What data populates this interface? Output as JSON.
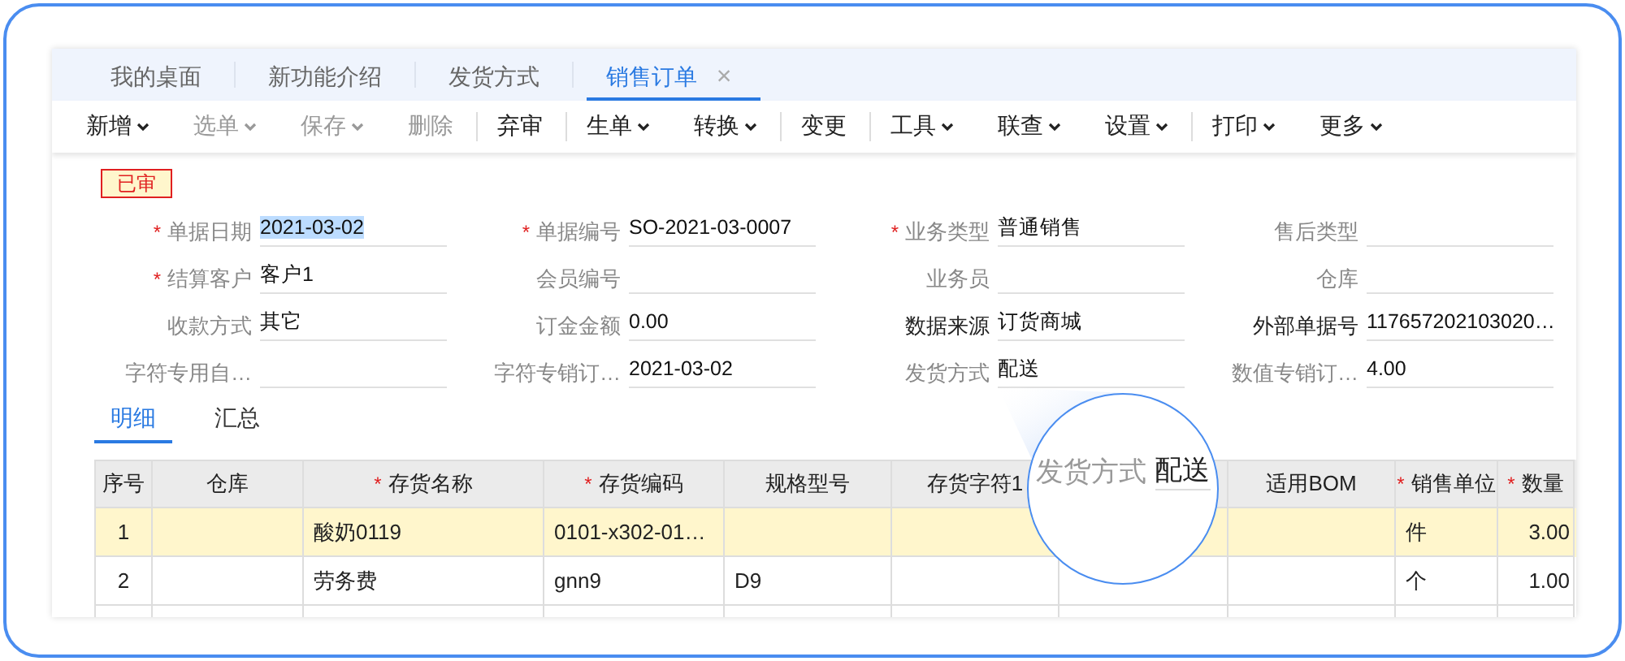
{
  "tabs": [
    {
      "label": "我的桌面",
      "selected": false,
      "closable": false
    },
    {
      "label": "新功能介绍",
      "selected": false,
      "closable": false
    },
    {
      "label": "发货方式",
      "selected": false,
      "closable": false
    },
    {
      "label": "销售订单",
      "selected": true,
      "closable": true
    }
  ],
  "close_glyph": "×",
  "toolbar": [
    {
      "label": "新增",
      "dropdown": true,
      "disabled": false,
      "separator_before": false
    },
    {
      "label": "选单",
      "dropdown": true,
      "disabled": true,
      "separator_before": false
    },
    {
      "label": "保存",
      "dropdown": true,
      "disabled": true,
      "separator_before": false
    },
    {
      "label": "删除",
      "dropdown": false,
      "disabled": true,
      "separator_before": false
    },
    {
      "label": "弃审",
      "dropdown": false,
      "disabled": false,
      "separator_before": true
    },
    {
      "label": "生单",
      "dropdown": true,
      "disabled": false,
      "separator_before": true
    },
    {
      "label": "转换",
      "dropdown": true,
      "disabled": false,
      "separator_before": false
    },
    {
      "label": "变更",
      "dropdown": false,
      "disabled": false,
      "separator_before": true
    },
    {
      "label": "工具",
      "dropdown": true,
      "disabled": false,
      "separator_before": true
    },
    {
      "label": "联查",
      "dropdown": true,
      "disabled": false,
      "separator_before": false
    },
    {
      "label": "设置",
      "dropdown": true,
      "disabled": false,
      "separator_before": false
    },
    {
      "label": "打印",
      "dropdown": true,
      "disabled": false,
      "separator_before": true
    },
    {
      "label": "更多",
      "dropdown": true,
      "disabled": false,
      "separator_before": false
    }
  ],
  "status_badge": "已审",
  "required_mark": "*",
  "fields": [
    {
      "label": "单据日期",
      "value": "2021-03-02",
      "required": true,
      "dark_label": false,
      "highlighted": true
    },
    {
      "label": "单据编号",
      "value": "SO-2021-03-0007",
      "required": true,
      "dark_label": false,
      "highlighted": false
    },
    {
      "label": "业务类型",
      "value": "普通销售",
      "required": true,
      "dark_label": false,
      "highlighted": false
    },
    {
      "label": "售后类型",
      "required": false,
      "dark_label": false
    },
    {
      "label": "结算客户",
      "value": "客户1",
      "required": true,
      "dark_label": false,
      "highlighted": false
    },
    {
      "label": "会员编号",
      "required": false,
      "dark_label": false
    },
    {
      "label": "业务员",
      "required": false,
      "dark_label": false
    },
    {
      "label": "仓库",
      "required": false,
      "dark_label": false
    },
    {
      "label": "收款方式",
      "value": "其它",
      "required": false,
      "dark_label": false,
      "highlighted": false
    },
    {
      "label": "订金金额",
      "value": "0.00",
      "required": false,
      "dark_label": false,
      "highlighted": false
    },
    {
      "label": "数据来源",
      "value": "订货商城",
      "required": false,
      "dark_label": true,
      "highlighted": false
    },
    {
      "label": "外部单据号",
      "value": "117657202103020…",
      "required": false,
      "dark_label": true,
      "highlighted": false
    },
    {
      "label": "字符专用自…",
      "required": false,
      "dark_label": false
    },
    {
      "label": "字符专销订…",
      "value": "2021-03-02",
      "required": false,
      "dark_label": false,
      "highlighted": false
    },
    {
      "label": "发货方式",
      "value": "配送",
      "required": false,
      "dark_label": false,
      "highlighted": false
    },
    {
      "label": "数值专销订…",
      "value": "4.00",
      "required": false,
      "dark_label": false,
      "highlighted": false
    }
  ],
  "detail_tabs": [
    {
      "label": "明细",
      "selected": true
    },
    {
      "label": "汇总",
      "selected": false
    }
  ],
  "table": {
    "columns": [
      {
        "label": "序号",
        "required": false
      },
      {
        "label": "仓库",
        "required": false
      },
      {
        "label": "存货名称",
        "required": true
      },
      {
        "label": "存货编码",
        "required": true
      },
      {
        "label": "规格型号",
        "required": false
      },
      {
        "label": "存货字符1",
        "required": false
      },
      {},
      {
        "label": "适用BOM",
        "required": false
      },
      {
        "label": "销售单位",
        "required": true
      },
      {
        "label": "数量",
        "required": true
      }
    ],
    "rows": [
      {
        "selected": true,
        "cells": [
          "1",
          "",
          "酸奶0119",
          "0101-x302-01…",
          "",
          "",
          "",
          "",
          "件",
          "3.00"
        ]
      },
      {
        "selected": false,
        "cells": [
          "2",
          "",
          "劳务费",
          "gnn9",
          "D9",
          "",
          "",
          "",
          "个",
          "1.00"
        ]
      }
    ]
  },
  "magnifier": {
    "label": "发货方式",
    "value": "配送"
  }
}
